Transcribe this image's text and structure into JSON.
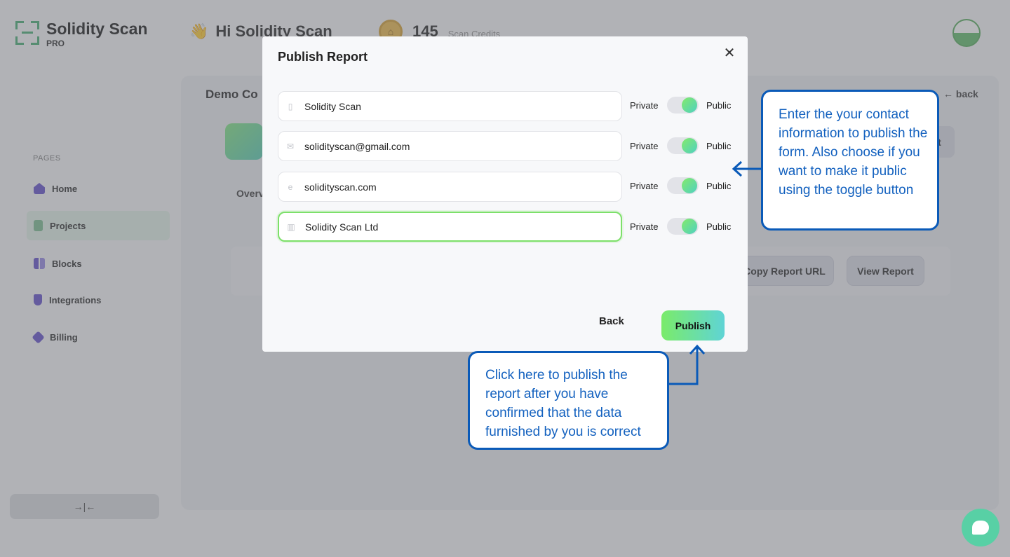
{
  "brand": {
    "name": "Solidity Scan",
    "tier": "PRO"
  },
  "header": {
    "greeting_emoji": "👋",
    "greeting": "Hi Solidity Scan",
    "credits_value": "145",
    "credits_label": "Scan Credits"
  },
  "sidebar": {
    "heading": "PAGES",
    "items": [
      {
        "label": "Home",
        "icon": "home-icon",
        "color": "#5b47c7"
      },
      {
        "label": "Projects",
        "icon": "document-icon",
        "color": "#74b98a",
        "active": true
      },
      {
        "label": "Blocks",
        "icon": "blocks-icon",
        "color": "#5b47c7"
      },
      {
        "label": "Integrations",
        "icon": "plug-icon",
        "color": "#5b47c7"
      },
      {
        "label": "Billing",
        "icon": "tag-icon",
        "color": "#5b47c7"
      }
    ],
    "collapse_icon": "→|←"
  },
  "page": {
    "title": "Demo Co",
    "back_label": "← back",
    "tab_overview": "Overv",
    "report_btn_fragment": "t",
    "copy_url_label": "Copy Report URL",
    "view_report_label": "View Report"
  },
  "modal": {
    "title": "Publish Report",
    "close_symbol": "✕",
    "fields": [
      {
        "value": "Solidity Scan",
        "icon": "building-icon",
        "private_label": "Private",
        "public_label": "Public",
        "public": true
      },
      {
        "value": "solidityscan@gmail.com",
        "icon": "envelope-icon",
        "private_label": "Private",
        "public_label": "Public",
        "public": true
      },
      {
        "value": "solidityscan.com",
        "icon": "globe-icon",
        "private_label": "Private",
        "public_label": "Public",
        "public": true
      },
      {
        "value": "Solidity Scan Ltd",
        "icon": "office-icon",
        "private_label": "Private",
        "public_label": "Public",
        "public": true
      }
    ],
    "back_label": "Back",
    "publish_label": "Publish"
  },
  "annotations": {
    "contact_callout": "Enter the your contact information to publish the form. Also choose if you want to make it public using the toggle button",
    "publish_callout": "Click here to publish the report after you have confirmed that the data furnished by you is correct"
  },
  "colors": {
    "accent_green": "#7aeb6a",
    "accent_teal": "#5fd4d5",
    "callout_blue": "#0a5ab8"
  }
}
